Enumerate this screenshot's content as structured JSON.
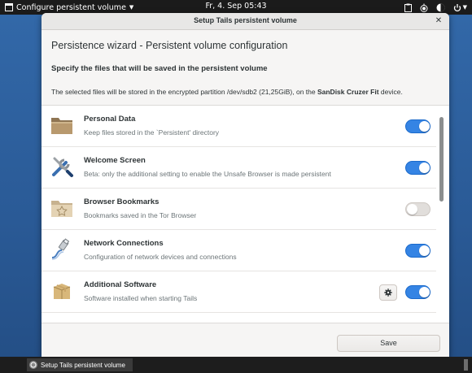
{
  "topbar": {
    "app_menu_label": "Configure persistent volume",
    "clock": "Fr, 4. Sep  05:43"
  },
  "window": {
    "title": "Setup Tails persistent volume",
    "heading": "Persistence wizard - Persistent volume configuration",
    "subheading": "Specify the files that will be saved in the persistent volume",
    "description_prefix": "The selected files will be stored in the encrypted partition /dev/sdb2 (21,25GiB), on the ",
    "device_name": "SanDisk Cruzer Fit",
    "description_suffix": " device.",
    "save_label": "Save"
  },
  "features": [
    {
      "name": "Personal Data",
      "description": "Keep files stored in the `Persistent' directory",
      "enabled": true,
      "icon": "folder-icon"
    },
    {
      "name": "Welcome Screen",
      "description": "Beta: only the additional setting to enable the Unsafe Browser is made persistent",
      "enabled": true,
      "icon": "tools-icon"
    },
    {
      "name": "Browser Bookmarks",
      "description": "Bookmarks saved in the Tor Browser",
      "enabled": false,
      "icon": "bookmark-folder-icon"
    },
    {
      "name": "Network Connections",
      "description": "Configuration of network devices and connections",
      "enabled": true,
      "icon": "network-icon"
    },
    {
      "name": "Additional Software",
      "description": "Software installed when starting Tails",
      "enabled": true,
      "icon": "package-icon"
    }
  ],
  "taskbar": {
    "task_label": "Setup Tails persistent volume"
  }
}
